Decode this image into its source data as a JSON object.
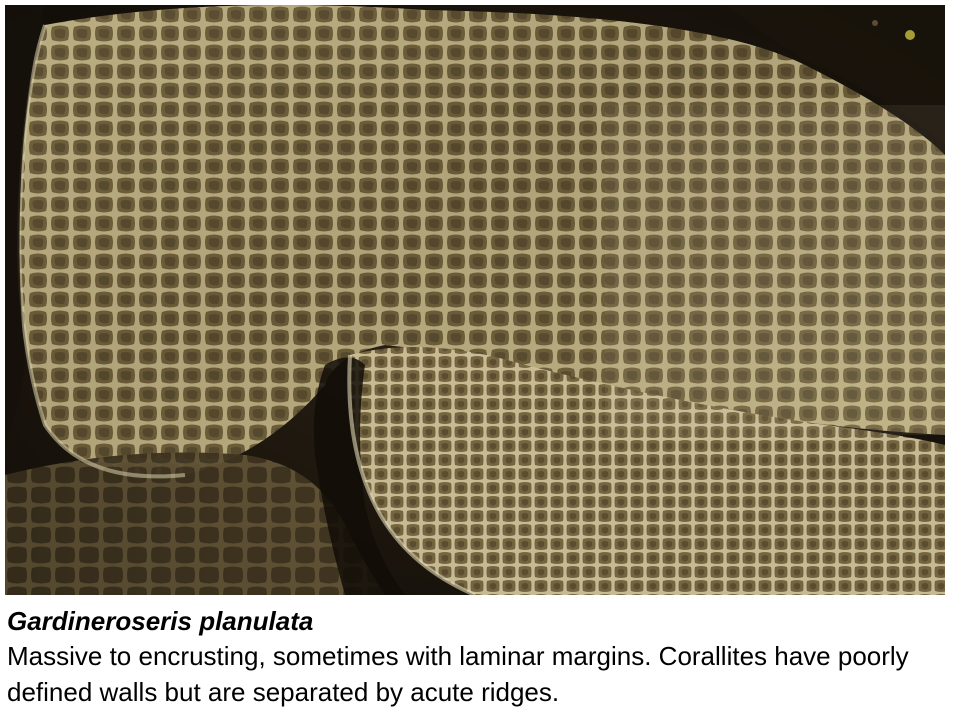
{
  "caption": {
    "species_name": "Gardineroseris planulata",
    "description": "Massive to encrusting, sometimes with laminar margins. Corallites have poorly defined walls but are separated by acute ridges."
  },
  "colors": {
    "background_dark": "#1a140c",
    "coral_base": "#8a7a52",
    "coral_ridge": "#d9cfa8",
    "corallite_pit": "#4a3e26",
    "caption_text": "#000000"
  }
}
